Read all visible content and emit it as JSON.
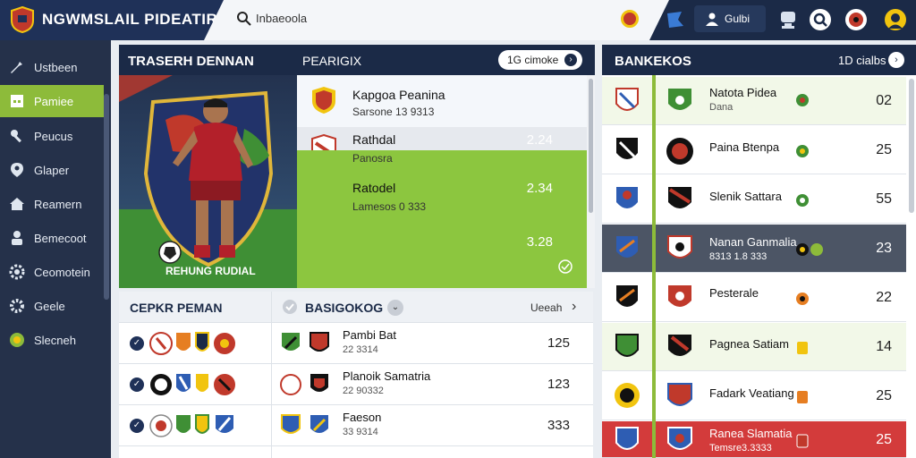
{
  "topbar": {
    "brand_title": "NGWMSLAIL PIDEATIR",
    "search_text": "Inbaeoola",
    "user_label": "Gulbi"
  },
  "icons": {
    "logo": "shield-logo-icon",
    "search": "search-icon",
    "coin": "coin-icon",
    "flag": "flag-icon",
    "user": "user-icon",
    "trophy": "trophy-icon",
    "magnifier": "magnifier-icon",
    "club": "club-badge-icon",
    "avatar": "avatar-icon"
  },
  "sidebar": {
    "items": [
      {
        "label": "Ustbeen",
        "icon": "wrench-icon"
      },
      {
        "label": "Pamiee",
        "icon": "building-icon"
      },
      {
        "label": "Peucus",
        "icon": "tools-icon"
      },
      {
        "label": "Glaper",
        "icon": "location-icon"
      },
      {
        "label": "Reamern",
        "icon": "house-icon"
      },
      {
        "label": "Bemecoot",
        "icon": "person-icon"
      },
      {
        "label": "Ceomotein",
        "icon": "gear-icon"
      },
      {
        "label": "Geele",
        "icon": "cog-icon"
      },
      {
        "label": "Slecneh",
        "icon": "globe-icon"
      }
    ],
    "active_index": 1
  },
  "featured": {
    "title": "TRASERH DENNAN",
    "subtitle": "PEARIGIX",
    "pill_label": "1G cimoke",
    "player_caption": "REHUNG RUDIAL",
    "list": [
      {
        "name": "Kapgoa Peanina",
        "sub": "Sarsone 13 9313",
        "value": ""
      },
      {
        "name": "Rathdal",
        "sub": "Panosra",
        "value": "2.24"
      },
      {
        "name": "Ratodel",
        "sub": "Lamesos 0 333",
        "value": "2.34"
      },
      {
        "name": "",
        "sub": "",
        "value": "3.28"
      }
    ]
  },
  "table": {
    "title": "CEPKR PEMAN",
    "subtitle": "BASIGOKOG",
    "action": "Ueeah",
    "rows": [
      {
        "name": "Pambi Bat",
        "sub": "22 3314",
        "value": "125"
      },
      {
        "name": "Planoik Samatria",
        "sub": "22 90332",
        "value": "123"
      },
      {
        "name": "Faeson",
        "sub": "33 9314",
        "value": "333"
      }
    ]
  },
  "rankings": {
    "title": "BANKEKOS",
    "action": "1D cialbs",
    "rows": [
      {
        "name": "Natota Pidea",
        "sub": "Dana",
        "value": "02",
        "style": "light"
      },
      {
        "name": "Paina Btenpa",
        "sub": "",
        "value": "25",
        "style": "white"
      },
      {
        "name": "Slenik Sattara",
        "sub": "",
        "value": "55",
        "style": "white"
      },
      {
        "name": "Nanan Ganmalia",
        "sub": "8313 1.8 333",
        "value": "23",
        "style": "dark"
      },
      {
        "name": "Pesterale",
        "sub": "",
        "value": "22",
        "style": "white"
      },
      {
        "name": "Pagnea Satiam",
        "sub": "",
        "value": "14",
        "style": "light"
      },
      {
        "name": "Fadark Veatiang",
        "sub": "",
        "value": "25",
        "style": "white"
      },
      {
        "name": "Ranea Slamatia",
        "sub": "Temsre3.3333",
        "value": "25",
        "style": "red"
      }
    ]
  },
  "colors": {
    "navy": "#1b2a47",
    "accent_green": "#8cc63f",
    "highlight_red": "#d33b3b"
  }
}
